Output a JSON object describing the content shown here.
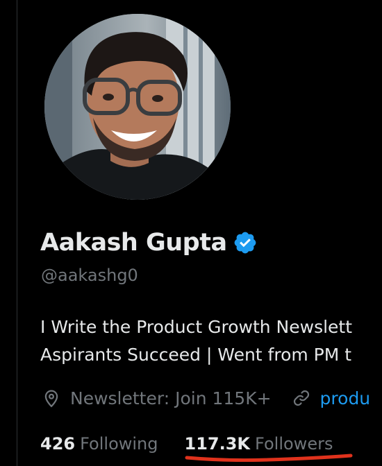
{
  "profile": {
    "display_name": "Aakash Gupta",
    "handle": "@aakashg0",
    "verified": true,
    "bio_lines": [
      "I Write the Product Growth Newslett",
      "Aspirants Succeed | Went from PM t"
    ],
    "location_text": "Newsletter: Join 115K+",
    "website_text": "produ"
  },
  "stats": {
    "following_count": "426",
    "following_label": "Following",
    "followers_count": "117.3K",
    "followers_label": "Followers"
  },
  "icons": {
    "verified": "verified-badge-icon",
    "location": "location-pin-icon",
    "link": "link-icon"
  },
  "colors": {
    "background": "#000000",
    "text_primary": "#e7e9ea",
    "text_secondary": "#71767b",
    "accent": "#1d9bf0",
    "annotation_underline": "#e0321c"
  }
}
